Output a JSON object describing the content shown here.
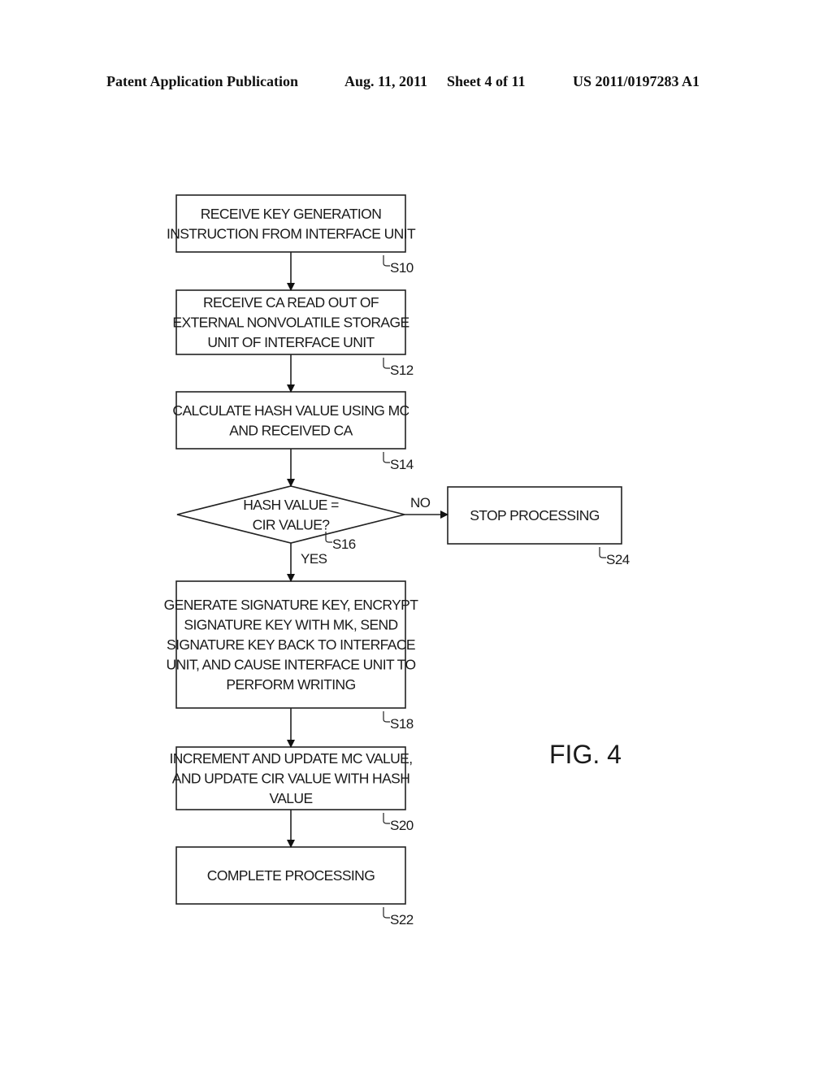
{
  "header": {
    "publication": "Patent Application Publication",
    "date": "Aug. 11, 2011",
    "sheet": "Sheet 4 of 11",
    "number": "US 2011/0197283 A1"
  },
  "figure_label": "FIG. 4",
  "steps": [
    {
      "id": "S10",
      "lines": [
        "RECEIVE KEY GENERATION",
        "INSTRUCTION FROM INTERFACE UNIT"
      ]
    },
    {
      "id": "S12",
      "lines": [
        "RECEIVE CA READ OUT OF",
        "EXTERNAL NONVOLATILE STORAGE",
        "UNIT OF INTERFACE UNIT"
      ]
    },
    {
      "id": "S14",
      "lines": [
        "CALCULATE HASH VALUE USING MC",
        "AND RECEIVED CA"
      ]
    },
    {
      "id": "S16",
      "lines": [
        "HASH VALUE =",
        "CIR VALUE?"
      ]
    },
    {
      "id": "S18",
      "lines": [
        "GENERATE SIGNATURE KEY, ENCRYPT",
        "SIGNATURE KEY WITH MK, SEND",
        "SIGNATURE KEY BACK TO INTERFACE",
        "UNIT, AND CAUSE INTERFACE UNIT TO",
        "PERFORM WRITING"
      ]
    },
    {
      "id": "S20",
      "lines": [
        "INCREMENT AND UPDATE MC VALUE,",
        "AND UPDATE CIR VALUE WITH HASH",
        "VALUE"
      ]
    },
    {
      "id": "S22",
      "lines": [
        "COMPLETE PROCESSING"
      ]
    },
    {
      "id": "S24",
      "lines": [
        "STOP PROCESSING"
      ]
    }
  ],
  "branches": {
    "no": "NO",
    "yes": "YES"
  }
}
